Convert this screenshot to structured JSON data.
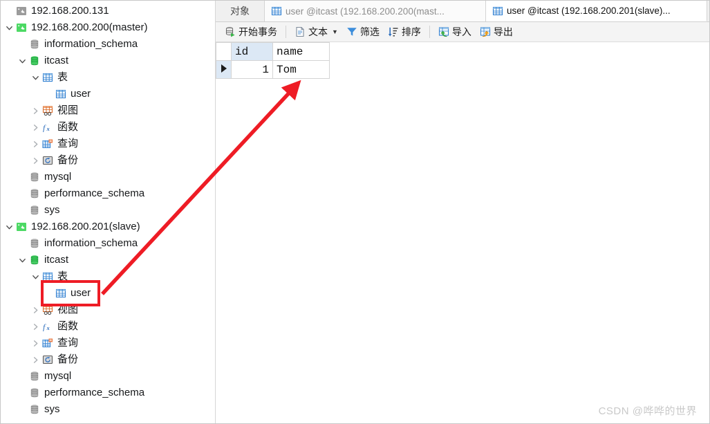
{
  "app": {
    "name": "Navicat",
    "accent_red": "#ee1c25",
    "highlight_blue": "#dce8f5",
    "connected_green": "#34c759"
  },
  "sidebar": {
    "name": "connection-tree",
    "nodes": [
      {
        "label": "192.168.200.131",
        "icon": "mysql-connection-icon",
        "state": "disconnected",
        "indent": 1,
        "twisty": "none"
      },
      {
        "label": "192.168.200.200(master)",
        "icon": "mysql-connection-icon",
        "state": "connected",
        "indent": 1,
        "twisty": "expanded"
      },
      {
        "label": "information_schema",
        "icon": "database-icon",
        "state": "closed",
        "indent": 2,
        "twisty": "none"
      },
      {
        "label": "itcast",
        "icon": "database-icon",
        "state": "open",
        "indent": 2,
        "twisty": "expanded"
      },
      {
        "label": "表",
        "icon": "tables-folder-icon",
        "state": "open",
        "indent": 3,
        "twisty": "expanded"
      },
      {
        "label": "user",
        "icon": "table-icon",
        "state": "none",
        "indent": 4,
        "twisty": "none"
      },
      {
        "label": "视图",
        "icon": "views-folder-icon",
        "state": "none",
        "indent": 3,
        "twisty": "collapsed"
      },
      {
        "label": "函数",
        "icon": "functions-folder-icon",
        "state": "none",
        "indent": 3,
        "twisty": "collapsed"
      },
      {
        "label": "查询",
        "icon": "queries-folder-icon",
        "state": "none",
        "indent": 3,
        "twisty": "collapsed"
      },
      {
        "label": "备份",
        "icon": "backups-folder-icon",
        "state": "none",
        "indent": 3,
        "twisty": "collapsed"
      },
      {
        "label": "mysql",
        "icon": "database-icon",
        "state": "closed",
        "indent": 2,
        "twisty": "none"
      },
      {
        "label": "performance_schema",
        "icon": "database-icon",
        "state": "closed",
        "indent": 2,
        "twisty": "none"
      },
      {
        "label": "sys",
        "icon": "database-icon",
        "state": "closed",
        "indent": 2,
        "twisty": "none"
      },
      {
        "label": "192.168.200.201(slave)",
        "icon": "mysql-connection-icon",
        "state": "connected",
        "indent": 1,
        "twisty": "expanded"
      },
      {
        "label": "information_schema",
        "icon": "database-icon",
        "state": "closed",
        "indent": 2,
        "twisty": "none"
      },
      {
        "label": "itcast",
        "icon": "database-icon",
        "state": "open",
        "indent": 2,
        "twisty": "expanded"
      },
      {
        "label": "表",
        "icon": "tables-folder-icon",
        "state": "open",
        "indent": 3,
        "twisty": "expanded"
      },
      {
        "label": "user",
        "icon": "table-icon",
        "state": "none",
        "indent": 4,
        "twisty": "none",
        "highlighted": true
      },
      {
        "label": "视图",
        "icon": "views-folder-icon",
        "state": "none",
        "indent": 3,
        "twisty": "collapsed"
      },
      {
        "label": "函数",
        "icon": "functions-folder-icon",
        "state": "none",
        "indent": 3,
        "twisty": "collapsed"
      },
      {
        "label": "查询",
        "icon": "queries-folder-icon",
        "state": "none",
        "indent": 3,
        "twisty": "collapsed"
      },
      {
        "label": "备份",
        "icon": "backups-folder-icon",
        "state": "none",
        "indent": 3,
        "twisty": "collapsed"
      },
      {
        "label": "mysql",
        "icon": "database-icon",
        "state": "closed",
        "indent": 2,
        "twisty": "none"
      },
      {
        "label": "performance_schema",
        "icon": "database-icon",
        "state": "closed",
        "indent": 2,
        "twisty": "none"
      },
      {
        "label": "sys",
        "icon": "database-icon",
        "state": "closed",
        "indent": 2,
        "twisty": "none"
      }
    ]
  },
  "tabstrip": {
    "object_tab_label": "对象",
    "tabs": [
      {
        "label": "user @itcast (192.168.200.200(mast...",
        "icon": "table-icon",
        "active": false
      },
      {
        "label": "user @itcast (192.168.200.201(slave)...",
        "icon": "table-icon",
        "active": true
      }
    ]
  },
  "toolbar": {
    "items": [
      {
        "label": "开始事务",
        "icon": "begin-transaction-icon",
        "caret": false
      },
      {
        "label": "文本",
        "icon": "text-icon",
        "caret": true
      },
      {
        "label": "筛选",
        "icon": "filter-icon",
        "caret": false
      },
      {
        "label": "排序",
        "icon": "sort-icon",
        "caret": false
      },
      {
        "label": "导入",
        "icon": "import-icon",
        "caret": false
      },
      {
        "label": "导出",
        "icon": "export-icon",
        "caret": false
      }
    ]
  },
  "grid": {
    "columns": [
      "id",
      "name"
    ],
    "rows": [
      {
        "current": true,
        "cells": [
          "1",
          "Tom"
        ]
      }
    ]
  },
  "annotations": {
    "highlight_box": {
      "color": "#ee1c25"
    },
    "arrow": {
      "color": "#ee1c25",
      "from": "tree-user-node",
      "to": "result-grid"
    }
  },
  "watermark": {
    "text": "CSDN @哗哗的世界"
  }
}
